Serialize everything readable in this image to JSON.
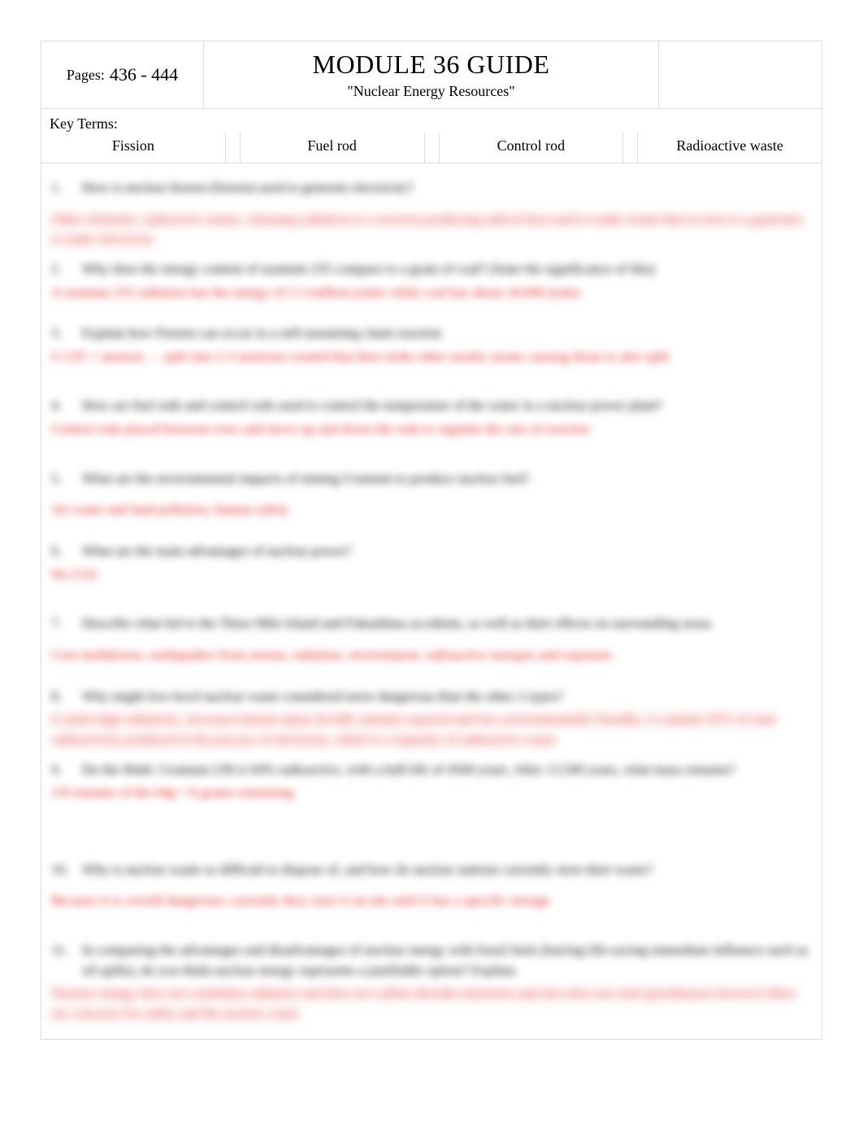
{
  "header": {
    "pages_label": "Pages:",
    "pages_value": "436 - 444",
    "title": "MODULE 36 GUIDE",
    "subtitle": "\"Nuclear Energy Resources\""
  },
  "keyterms": {
    "label": "Key Terms:",
    "items": [
      "Fission",
      "Fuel rod",
      "Control rod",
      "Radioactive waste"
    ]
  },
  "questions": [
    {
      "n": "1.",
      "q": "How is nuclear fission (fission) used to generate electricity?",
      "a": "Other elements, radioactive atoms, releasing radiation in a reaction producing radical heat used to make steam that in turn to a generator to make electricity"
    },
    {
      "n": "2.",
      "q": "Why does the energy content of uranium 235 compare to a gram of coal? (State the significance of this)",
      "a": "A uranium 235 radiation has the energy of 2-3 million joules while coal has about 24,000 joules"
    },
    {
      "n": "3.",
      "q": "Explain how Fission can occur in a self-sustaining chain reaction",
      "a": "U-235 + neutron → split into 2-3 neutrons created that then strike other nearby atoms causing those to also split"
    },
    {
      "n": "4.",
      "q": "How are fuel rods and control rods used to control the temperature of the water in a nuclear power plant?",
      "a": "Control rods placed between rows and move up and down the rods to regulate the rate of reaction"
    },
    {
      "n": "5.",
      "q": "What are the environmental impacts of mining Uranium to produce nuclear fuel?",
      "a": "Air water and land pollution, human safety"
    },
    {
      "n": "6.",
      "q": "What are the main advantages of nuclear power?",
      "a": "No CO2"
    },
    {
      "n": "7.",
      "q": "Describe what led to the Three Mile Island and Fukushima accidents, as well as their effects on surrounding areas.",
      "a": "Core meltdowns, earthquakes from storms, radiation, environment, radioactive isotopes and exposure"
    },
    {
      "n": "8.",
      "q": "Why might low-level nuclear waste considered more dangerous than the other 2 types?",
      "a": "It emits high radiations, increases human injury & kills animals exposed and less environmentally friendly; it contains 95% of total radioactivity produced in the process of electricity, which is a majority of radioactive waste"
    },
    {
      "n": "9.",
      "q": "Do the Math: Uranium-238 is 64% radioactive, with a half-life of 4500 years. After 13,500 years, what mass remains?",
      "a": "1/8 remains of the 64g = 8 grams remaining"
    },
    {
      "n": "10.",
      "q": "Why is nuclear waste so difficult to dispose of, and how do nuclear stations currently store their waste?",
      "a": "Because it is overall dangerous; currently they store it on site until it has a specific storage"
    },
    {
      "n": "11.",
      "q": "In comparing the advantages and disadvantages of nuclear energy with fossil fuels (barring life-saving immediate influence such as oil spills), do you think nuclear energy represents a justifiable option? Explain.",
      "a": "Nuclear energy does not contribute radiation and does not carbon dioxide emissions and also does not emit greenhouses however there are concerns for safety and the nuclear waste"
    }
  ]
}
